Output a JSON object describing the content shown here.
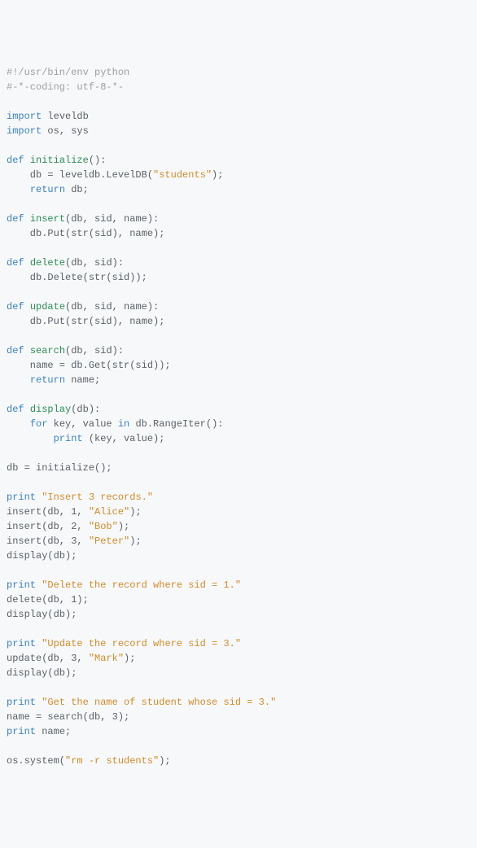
{
  "shebang": "#!/usr/bin/env python",
  "coding": "#-*-coding: utf-8-*-",
  "kw": {
    "import": "import",
    "def": "def",
    "return": "return",
    "_for": "for",
    "_in": "in",
    "print": "print"
  },
  "mod": {
    "leveldb": "leveldb",
    "os_sys": "os, sys"
  },
  "fn": {
    "initialize": "initialize",
    "insert": "insert",
    "delete": "delete",
    "update": "update",
    "search": "search",
    "display": "display"
  },
  "sig": {
    "initialize": "():",
    "insert": "(db, sid, name):",
    "delete": "(db, sid):",
    "update": "(db, sid, name):",
    "search": "(db, sid):",
    "display": "(db):"
  },
  "body": {
    "init_assign_pre": "    db = leveldb.LevelDB(",
    "init_assign_post": ");",
    "init_ret": " db;",
    "insert_put": "    db.Put(str(sid), name);",
    "delete_del": "    db.Delete(str(sid));",
    "update_put": "    db.Put(str(sid), name);",
    "search_get": "    name = db.Get(str(sid));",
    "search_ret": " name;",
    "display_for_head": " key, value ",
    "display_for_tail": " db.RangeIter():",
    "display_print_args": " (key, value);"
  },
  "str": {
    "students": "\"students\"",
    "alice": "\"Alice\"",
    "bob": "\"Bob\"",
    "peter": "\"Peter\"",
    "mark": "\"Mark\"",
    "insert3": "\"Insert 3 records.\"",
    "del1": "\"Delete the record where sid = 1.\"",
    "upd3": "\"Update the record where sid = 3.\"",
    "get3": "\"Get the name of student whose sid = 3.\"",
    "rm": "\"rm -r students\""
  },
  "main": {
    "db_init": "db = initialize();",
    "ins1_pre": "insert(db, 1, ",
    "ins_post": ");",
    "ins2_pre": "insert(db, 2, ",
    "ins3_pre": "insert(db, 3, ",
    "display": "display(db);",
    "del1": "delete(db, 1);",
    "upd3_pre": "update(db, 3, ",
    "search3": "name = search(db, 3);",
    "print_name": " name;",
    "os_pre": "os.system(",
    "os_post": ");",
    "indent4": "    ",
    "indent8": "        "
  }
}
